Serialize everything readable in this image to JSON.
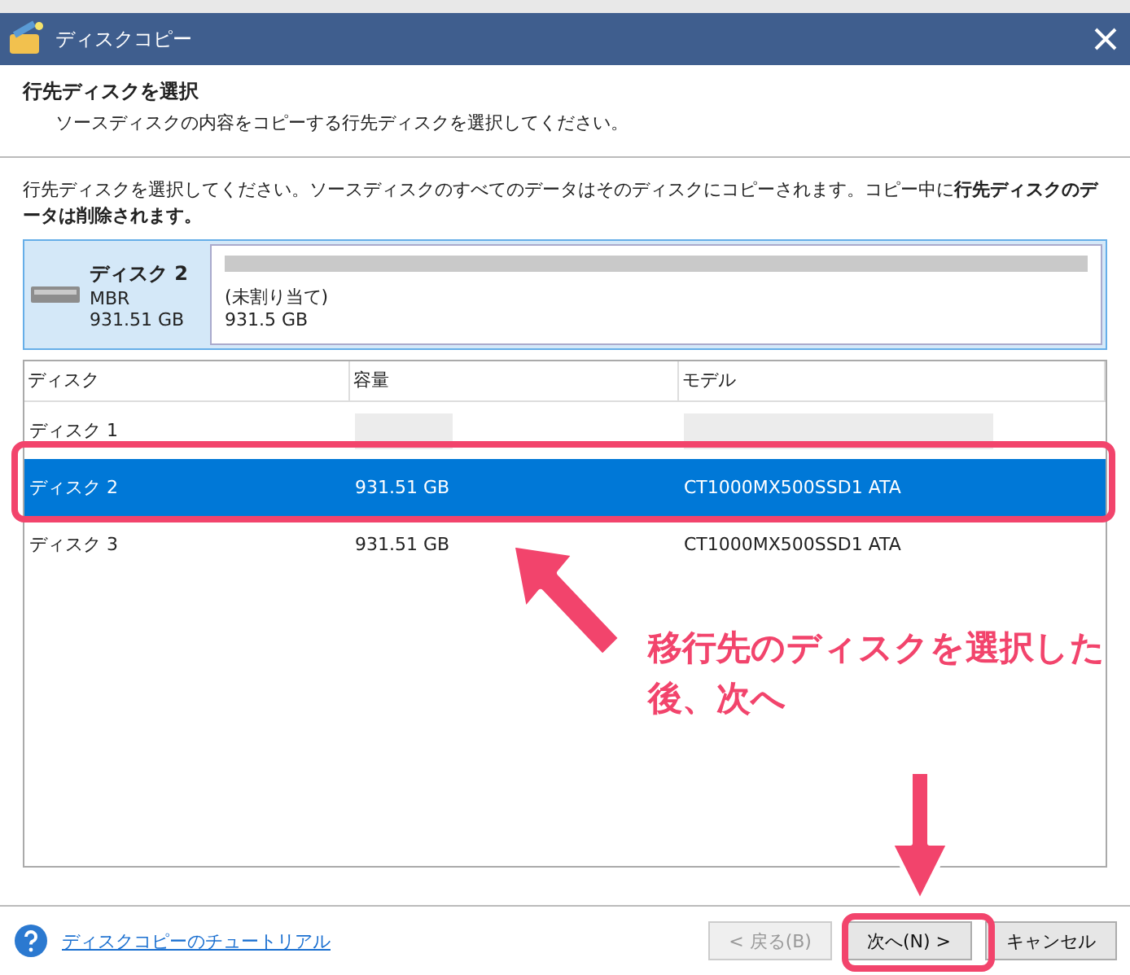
{
  "window": {
    "title": "ディスクコピー"
  },
  "header": {
    "title": "行先ディスクを選択",
    "subtitle": "ソースディスクの内容をコピーする行先ディスクを選択してください。"
  },
  "instruction": "行先ディスクを選択してください。ソースディスクのすべてのデータはそのディスクにコピーされます。コピー中に**行先ディスクのデータは削除されます。**",
  "disk_card": {
    "name": "ディスク 2",
    "scheme": "MBR",
    "size": "931.51 GB",
    "partition_label": "(未割り当て)",
    "partition_size": "931.5 GB"
  },
  "table": {
    "columns": [
      "ディスク",
      "容量",
      "モデル"
    ],
    "rows": [
      {
        "disk": "ディスク 1",
        "selected": false
      },
      {
        "disk": "ディスク 2",
        "capacity": "931.51 GB",
        "model": "CT1000MX500SSD1 ATA",
        "selected": true
      },
      {
        "disk": "ディスク 3",
        "capacity": "931.51 GB",
        "model": "CT1000MX500SSD1 ATA",
        "selected": false
      }
    ]
  },
  "footer": {
    "help_link": "ディスクコピーのチュートリアル",
    "buttons": [
      {
        "label": "< 戻る(B)",
        "disabled": true
      },
      {
        "label": "次へ(N) >",
        "disabled": false
      },
      {
        "label": "キャンセル",
        "disabled": false
      }
    ]
  },
  "annotation": {
    "caption": "移行先のディスクを選択した後、次へ"
  }
}
